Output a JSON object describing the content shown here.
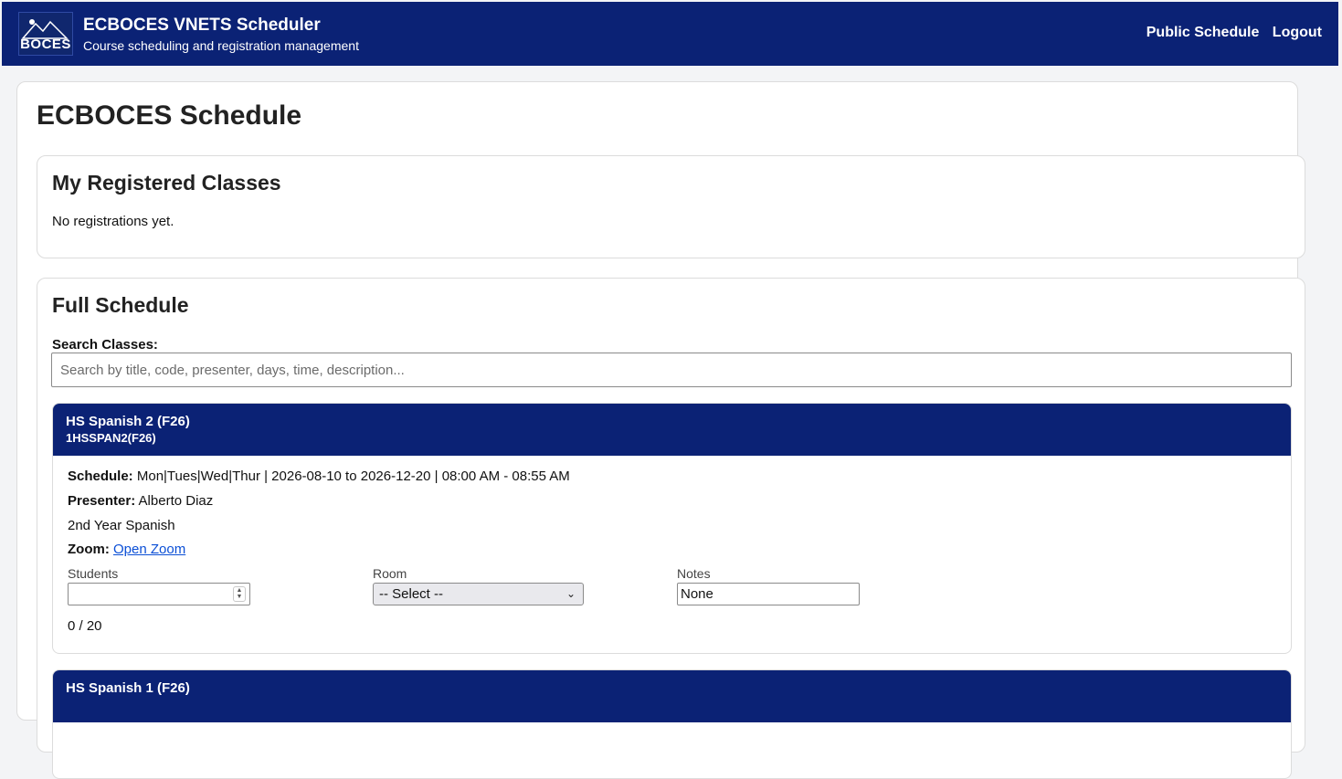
{
  "header": {
    "logo_text": "BOCES",
    "title": "ECBOCES VNETS Scheduler",
    "subtitle": "Course scheduling and registration management",
    "nav": [
      "Public Schedule",
      "Logout"
    ]
  },
  "page": {
    "title": "ECBOCES Schedule"
  },
  "registered": {
    "heading": "My Registered Classes",
    "empty_message": "No registrations yet."
  },
  "full_schedule": {
    "heading": "Full Schedule",
    "search_label": "Search Classes:",
    "search_placeholder": "Search by title, code, presenter, days, time, description...",
    "classes": [
      {
        "title": "HS Spanish 2 (F26)",
        "code": "1HSSPAN2(F26)",
        "schedule_label": "Schedule:",
        "schedule": "Mon|Tues|Wed|Thur | 2026-08-10 to 2026-12-20 | 08:00 AM - 08:55 AM",
        "presenter_label": "Presenter:",
        "presenter": "Alberto Diaz",
        "description": "2nd Year Spanish",
        "zoom_label": "Zoom:",
        "zoom_link": "Open Zoom",
        "students_label": "Students",
        "students_value": "",
        "room_label": "Room",
        "room_value": "-- Select --",
        "notes_label": "Notes",
        "notes_value": "None",
        "count": "0 / 20"
      },
      {
        "title": "HS Spanish 1 (F26)"
      }
    ]
  },
  "colors": {
    "header_bg": "#0b2275",
    "link": "#0b4fd6",
    "page_bg": "#f3f4f6"
  }
}
